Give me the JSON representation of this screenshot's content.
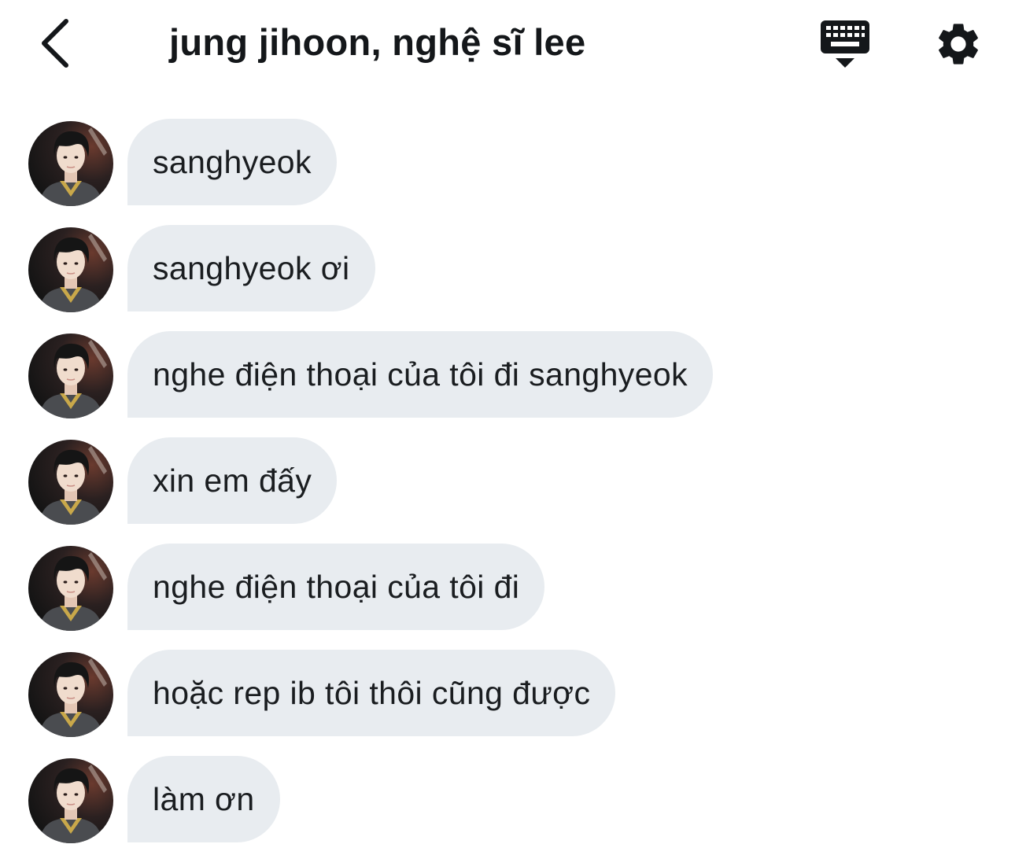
{
  "header": {
    "title": "jung jihoon, nghệ sĩ lee",
    "back_icon": "chevron-left-icon",
    "keyboard_icon": "keyboard-hide-icon",
    "settings_icon": "gear-icon"
  },
  "colors": {
    "bubble_bg": "#e8ecf0",
    "text": "#14171a",
    "avatar_jersey_trim": "#c9a84a"
  },
  "messages": [
    {
      "text": "sanghyeok"
    },
    {
      "text": "sanghyeok ơi"
    },
    {
      "text": "nghe điện thoại của tôi đi sanghyeok"
    },
    {
      "text": "xin em đấy"
    },
    {
      "text": "nghe điện thoại của tôi đi"
    },
    {
      "text": "hoặc rep ib tôi thôi cũng được"
    },
    {
      "text": "làm ơn"
    }
  ]
}
